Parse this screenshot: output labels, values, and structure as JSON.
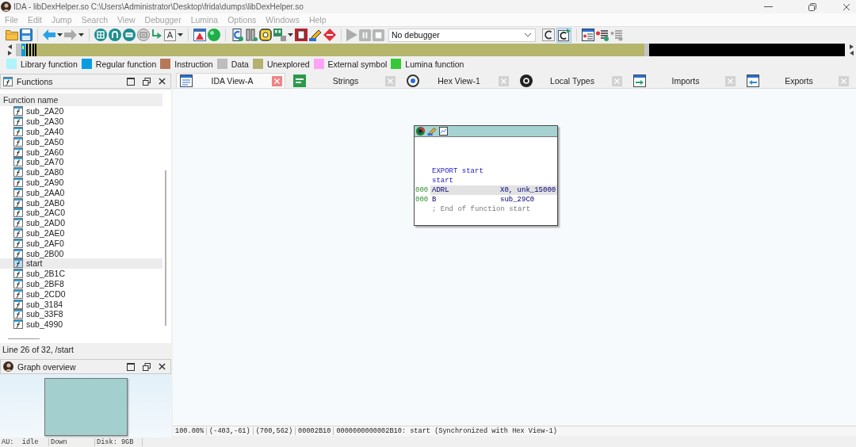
{
  "window": {
    "title": "IDA - libDexHelper.so C:\\Users\\Administrator\\Desktop\\frida\\dumps\\libDexHelper.so"
  },
  "menu": [
    {
      "label": "File",
      "disabled": true
    },
    {
      "label": "Edit",
      "disabled": true
    },
    {
      "label": "Jump",
      "disabled": true
    },
    {
      "label": "Search",
      "disabled": true
    },
    {
      "label": "View",
      "disabled": true
    },
    {
      "label": "Debugger",
      "disabled": true
    },
    {
      "label": "Lumina",
      "disabled": true
    },
    {
      "label": "Options",
      "disabled": true
    },
    {
      "label": "Windows",
      "disabled": true
    },
    {
      "label": "Help",
      "disabled": true
    }
  ],
  "toolbar": {
    "back": {
      "disabled": false
    },
    "forward": {
      "disabled": true
    },
    "font_button": "A",
    "debug_buttons": {
      "disabled": true
    },
    "debugger": "No debugger",
    "toggle": {
      "pressed": true
    }
  },
  "legend": [
    {
      "label": "Library function",
      "color": "#aef4fa"
    },
    {
      "label": "Regular function",
      "color": "#089de3"
    },
    {
      "label": "Instruction",
      "color": "#b7785a"
    },
    {
      "label": "Data",
      "color": "#bdbdbd"
    },
    {
      "label": "Unexplored",
      "color": "#b3b36f"
    },
    {
      "label": "External symbol",
      "color": "#fda4f6"
    },
    {
      "label": "Lumina function",
      "color": "#37c837"
    }
  ],
  "functions_panel": {
    "title": "Functions",
    "column": "Function name",
    "rows": [
      {
        "name": "sub_2A20",
        "selected": false
      },
      {
        "name": "sub_2A30",
        "selected": false
      },
      {
        "name": "sub_2A40",
        "selected": false
      },
      {
        "name": "sub_2A50",
        "selected": false
      },
      {
        "name": "sub_2A60",
        "selected": false
      },
      {
        "name": "sub_2A70",
        "selected": false
      },
      {
        "name": "sub_2A80",
        "selected": false
      },
      {
        "name": "sub_2A90",
        "selected": false
      },
      {
        "name": "sub_2AA0",
        "selected": false
      },
      {
        "name": "sub_2AB0",
        "selected": false
      },
      {
        "name": "sub_2AC0",
        "selected": false
      },
      {
        "name": "sub_2AD0",
        "selected": false
      },
      {
        "name": "sub_2AE0",
        "selected": false
      },
      {
        "name": "sub_2AF0",
        "selected": false
      },
      {
        "name": "sub_2B00",
        "selected": false
      },
      {
        "name": "start",
        "selected": true
      },
      {
        "name": "sub_2B1C",
        "selected": false
      },
      {
        "name": "sub_2BF8",
        "selected": false
      },
      {
        "name": "sub_2CD0",
        "selected": false
      },
      {
        "name": "sub_3184",
        "selected": false
      },
      {
        "name": "sub_33F8",
        "selected": false
      },
      {
        "name": "sub_4990",
        "selected": false
      }
    ],
    "status": "Line 26 of 32, /start"
  },
  "graph_overview": {
    "title": "Graph overview"
  },
  "tabs": [
    {
      "label": "IDA View-A",
      "selected": true
    },
    {
      "label": "Strings",
      "selected": false
    },
    {
      "label": "Hex View-1",
      "selected": false
    },
    {
      "label": "Local Types",
      "selected": false
    },
    {
      "label": "Imports",
      "selected": false
    },
    {
      "label": "Exports",
      "selected": false
    }
  ],
  "graph_node": {
    "lines": [
      {
        "kind": "label",
        "text": "EXPORT start"
      },
      {
        "kind": "label",
        "text": "start"
      },
      {
        "kind": "instruction",
        "sp": "000",
        "mnemonic": "ADRL",
        "operands": "X0, unk_15000",
        "highlighted": true
      },
      {
        "kind": "instruction",
        "sp": "000",
        "mnemonic": "B",
        "operands": "sub_29C0",
        "highlighted": false
      },
      {
        "kind": "comment",
        "text": "; End of function start"
      }
    ]
  },
  "graph_status": [
    "100.00%",
    "(-403,-61)",
    "(700,562)",
    "00002B10",
    "0000000000002B10: start (Synchronized with Hex View-1)"
  ],
  "status_bar": [
    "AU:  idle",
    "Down",
    "Disk: 9GB"
  ]
}
